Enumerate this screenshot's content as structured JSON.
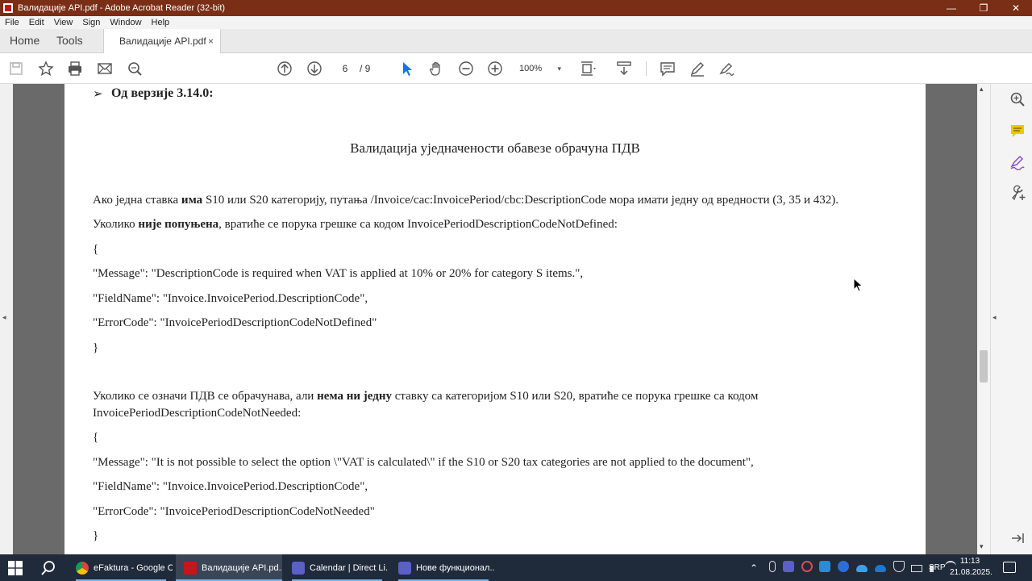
{
  "window": {
    "title": "Валидације API.pdf - Adobe Acrobat Reader (32-bit)",
    "controls": {
      "minimize": "—",
      "maximize": "❐",
      "close": "✕"
    }
  },
  "menu": [
    "File",
    "Edit",
    "View",
    "Sign",
    "Window",
    "Help"
  ],
  "tabs": {
    "home": "Home",
    "tools": "Tools",
    "document": "Валидације API.pdf",
    "close": "×"
  },
  "toolbar": {
    "page_current": "6",
    "page_total": "/ 9",
    "zoom": "100%",
    "zoom_caret": "▾",
    "icons": [
      "save-icon",
      "bookmark-star-icon",
      "print-icon",
      "email-icon",
      "search-icon",
      "page-up-icon",
      "page-down-icon",
      "select-cursor-icon",
      "hand-tool-icon",
      "zoom-out-icon",
      "zoom-in-icon",
      "page-fit-icon",
      "scroll-mode-icon",
      "comment-icon",
      "highlight-icon",
      "sign-icon"
    ]
  },
  "document": {
    "heading_bullet": "➢",
    "heading": "Од верзије 3.14.0:",
    "center_title": "Валидација уједначености обавезе обрачуна ПДВ",
    "p1": {
      "a": "Ако једна ставка ",
      "b": "има",
      "c": " S10 или S20 категорију, путања /Invoice/cac:InvoicePeriod/cbc:DescriptionCode мора имати једну од вредности (3, 35 и 432)."
    },
    "p2": {
      "a": "Уколико ",
      "b": "није попуњена",
      "c": ", вратиће се порука грешке са кодом InvoicePeriodDescriptionCodeNotDefined:"
    },
    "json1": {
      "open": "{",
      "message": " \"Message\": \"DescriptionCode is required when VAT is applied at 10% or 20% for category S items.\",",
      "field": " \"FieldName\": \"Invoice.InvoicePeriod.DescriptionCode\",",
      "error": " \"ErrorCode\": \"InvoicePeriodDescriptionCodeNotDefined\"",
      "close": "}"
    },
    "p3": {
      "a": "Уколико се означи ПДВ се обрачунава, али ",
      "b": "нема ни једну",
      "c": " ставку са категоријом S10 или S20, вратиће се порука грешке са кодом",
      "d": "InvoicePeriodDescriptionCodeNotNeeded:"
    },
    "json2": {
      "open": "{",
      "message": "\"Message\": \"It is not possible to select the option \\\"VAT is calculated\\\" if the S10 or S20 tax categories are not applied to the document\",",
      "field": "\"FieldName\": \"Invoice.InvoicePeriod.DescriptionCode\",",
      "error": "\"ErrorCode\": \"InvoicePeriodDescriptionCodeNotNeeded\"",
      "close": "}"
    }
  },
  "side_arrows": {
    "left": "◂",
    "right": "◂",
    "up": "▴",
    "down": "▾"
  },
  "right_panel_icons": [
    "zoom-search-icon",
    "comment-panel-icon",
    "fill-sign-icon",
    "more-tools-icon",
    "expand-panel-icon"
  ],
  "taskbar": {
    "apps": [
      {
        "label": "eFaktura - Google C...",
        "color": "#e8a33b"
      },
      {
        "label": "Валидације API.pd...",
        "color": "#c4161c"
      },
      {
        "label": "Calendar | Direct Li...",
        "color": "#5b5fc7"
      },
      {
        "label": "Нове функционал...",
        "color": "#5b5fc7"
      }
    ],
    "lang": "SRP",
    "time": "11:13",
    "date": "21.08.2025."
  },
  "colors": {
    "titlebar": "#7a2e16",
    "accent": "#1473e6",
    "taskbar": "#1f2a3a"
  }
}
